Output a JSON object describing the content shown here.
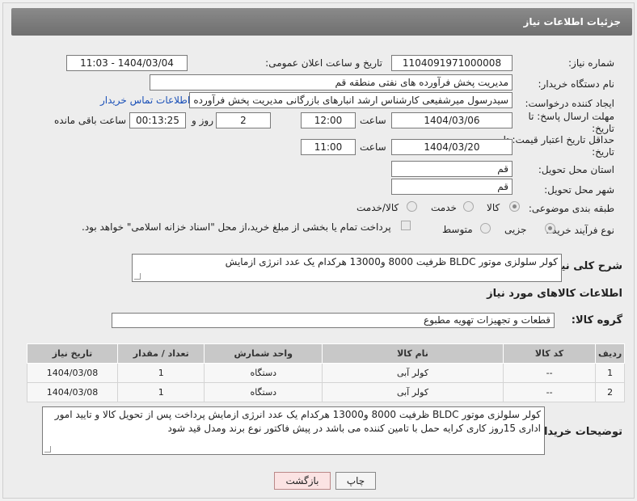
{
  "header": {
    "title": "جزئیات اطلاعات نیاز"
  },
  "fields": {
    "need_number_label": "شماره نیاز:",
    "need_number": "1104091971000008",
    "announce_label": "تاریخ و ساعت اعلان عمومی:",
    "announce_value": "1404/03/04 - 11:03",
    "buyer_label": "نام دستگاه خریدار:",
    "buyer_value": "مدیریت پخش فرآورده های نفتی منطقه قم",
    "creator_label": "ایجاد کننده درخواست:",
    "creator_value": "سیدرسول میرشفیعی کارشناس ارشد انبارهای بازرگانی مدیریت پخش فرآورده د",
    "contact_link": "اطلاعات تماس خریدار",
    "deadline_label": "مهلت ارسال پاسخ: تا تاریخ:",
    "deadline_date": "1404/03/06",
    "time_label": "ساعت",
    "deadline_time": "12:00",
    "remaining_days": "2",
    "day_and_label": "روز و",
    "remaining_time": "00:13:25",
    "remaining_label": "ساعت باقی مانده",
    "price_label": "حداقل تاریخ اعتبار قیمت: تا تاریخ:",
    "price_date": "1404/03/20",
    "price_time": "11:00",
    "province_label": "استان محل تحویل:",
    "province_value": "قم",
    "city_label": "شهر محل تحویل:",
    "city_value": "قم",
    "category_label": "طبقه بندی موضوعی:",
    "category_options": [
      "کالا",
      "خدمت",
      "کالا/خدمت"
    ],
    "purchase_label": "نوع فرآیند خرید :",
    "purchase_options": [
      "جزیی",
      "متوسط"
    ],
    "payment_note": "پرداخت تمام یا بخشی از مبلغ خرید،از محل \"اسناد خزانه اسلامی\" خواهد بود.",
    "summary_label": "شرح کلی نیاز:",
    "summary_value": "کولر سلولزی موتور BLDC ظرفیت 8000 و13000 هرکدام یک عدد  انرژی ازمایش"
  },
  "goods_section": {
    "title": "اطلاعات کالاهای مورد نیاز",
    "group_label": "گروه کالا:",
    "group_value": "قطعات و تجهیزات تهویه مطبوع"
  },
  "table": {
    "headers": [
      "ردیف",
      "کد کالا",
      "نام کالا",
      "واحد شمارش",
      "تعداد / مقدار",
      "تاریخ نیاز"
    ],
    "rows": [
      [
        "1",
        "--",
        "کولر آبی",
        "دستگاه",
        "1",
        "1404/03/08"
      ],
      [
        "2",
        "--",
        "کولر آبی",
        "دستگاه",
        "1",
        "1404/03/08"
      ]
    ]
  },
  "buyer_notes": {
    "label": "توضیحات خریدار:",
    "text": "کولر سلولزی موتور BLDC ظرفیت 8000 و13000 هرکدام یک عدد  انرژی ازمایش پرداخت پس از تحویل کالا و تایید امور اداری 15روز کاری کرایه حمل با تامین کننده می باشد  در پیش فاکتور نوع برند ومدل قید شود"
  },
  "buttons": {
    "print": "چاپ",
    "back": "بازگشت"
  }
}
